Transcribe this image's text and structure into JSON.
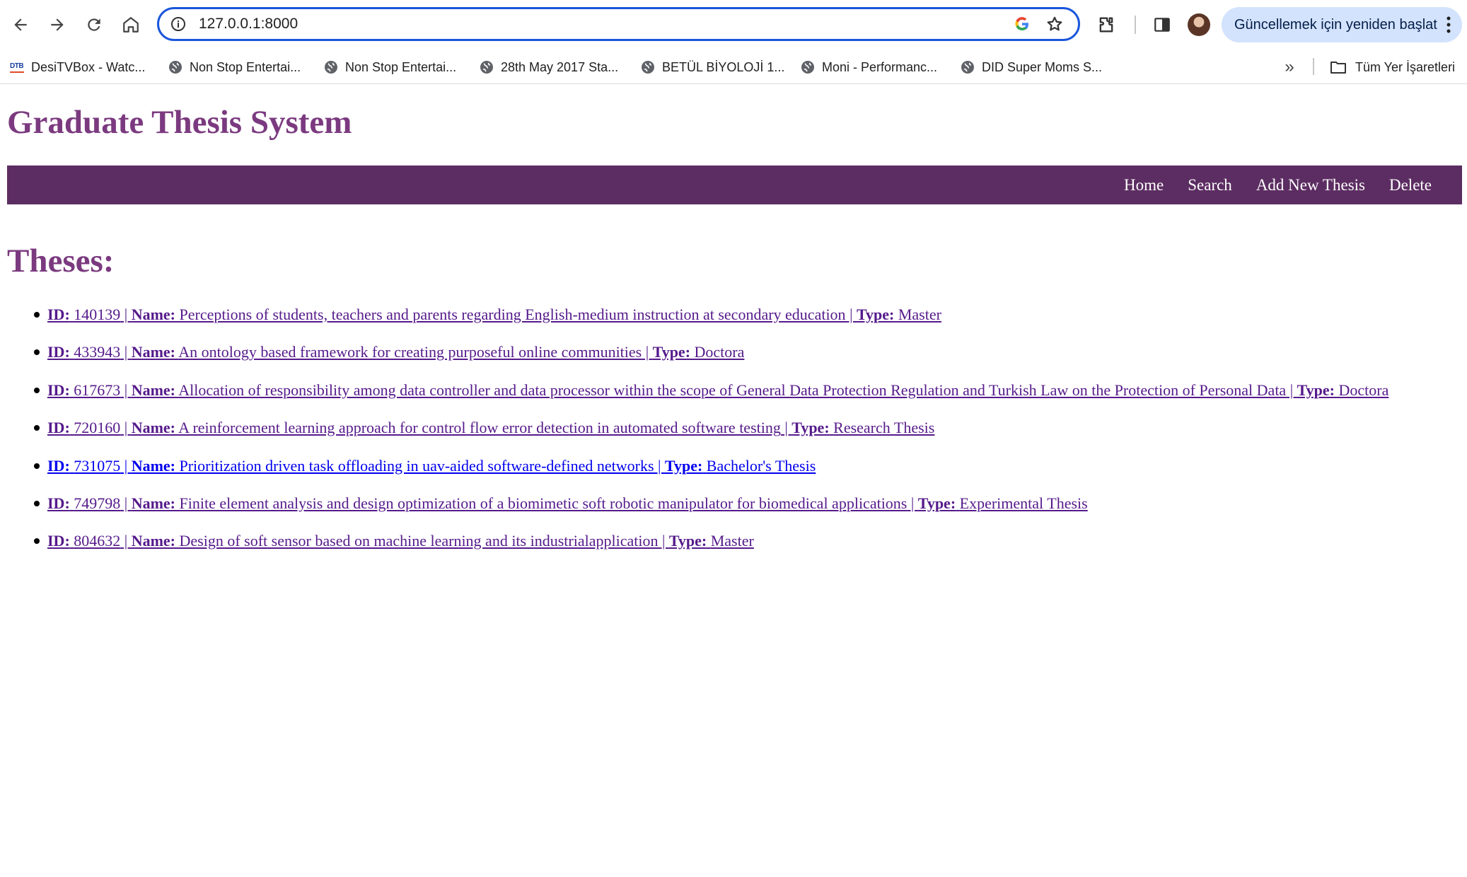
{
  "browser": {
    "url": "127.0.0.1:8000",
    "update_button_label": "Güncellemek için yeniden başlat",
    "bookmarks": [
      {
        "label": "DesiTVBox - Watc...",
        "icon": "dtb-favicon"
      },
      {
        "label": "Non Stop Entertai...",
        "icon": "globe-icon"
      },
      {
        "label": "Non Stop Entertai...",
        "icon": "globe-icon"
      },
      {
        "label": "28th May 2017 Sta...",
        "icon": "globe-icon"
      },
      {
        "label": "BETÜL BİYOLOJİ 1...",
        "icon": "globe-icon"
      },
      {
        "label": "Moni - Performanc...",
        "icon": "globe-icon"
      },
      {
        "label": "DID Super Moms S...",
        "icon": "globe-icon"
      }
    ],
    "more_bookmarks": "»",
    "all_bookmarks_label": "Tüm Yer İşaretleri"
  },
  "page": {
    "title": "Graduate Thesis System",
    "nav": [
      "Home",
      "Search",
      "Add New Thesis",
      "Delete"
    ],
    "section_title": "Theses:",
    "labels": {
      "id": "ID:",
      "name": "Name:",
      "type": "Type:"
    },
    "theses": [
      {
        "id": "140139",
        "name": "Perceptions of students, teachers and parents regarding English-medium instruction at secondary education",
        "type": "Master",
        "visited": true
      },
      {
        "id": "433943",
        "name": "An ontology based framework for creating purposeful online communities",
        "type": "Doctora",
        "visited": true
      },
      {
        "id": "617673",
        "name": "Allocation of responsibility among data controller and data processor within the scope of General Data Protection Regulation and Turkish Law on the Protection of Personal Data",
        "type": "Doctora",
        "visited": true
      },
      {
        "id": "720160",
        "name": "A reinforcement learning approach for control flow error detection in automated software testing",
        "type": "Research Thesis",
        "visited": true
      },
      {
        "id": "731075",
        "name": "Prioritization driven task offloading in uav-aided software-defined networks",
        "type": "Bachelor's Thesis",
        "visited": false
      },
      {
        "id": "749798",
        "name": "Finite element analysis and design optimization of a biomimetic soft robotic manipulator for biomedical applications",
        "type": "Experimental Thesis",
        "visited": true
      },
      {
        "id": "804632",
        "name": "Design of soft sensor based on machine learning and its industrialapplication",
        "type": "Master",
        "visited": true
      }
    ]
  }
}
